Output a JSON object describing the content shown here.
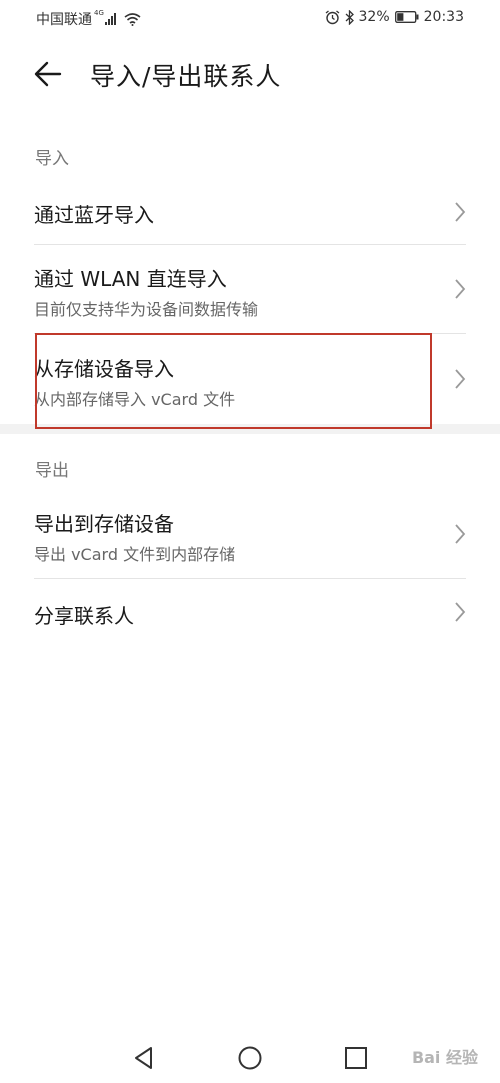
{
  "status_bar": {
    "carrier": "中国联通",
    "network": "4G",
    "battery": "32%",
    "time": "20:33"
  },
  "header": {
    "title": "导入/导出联系人",
    "back_icon": "arrow-left-icon"
  },
  "import_section": {
    "label": "导入",
    "items": [
      {
        "title": "通过蓝牙导入",
        "subtitle": ""
      },
      {
        "title": "通过 WLAN 直连导入",
        "subtitle": "目前仅支持华为设备间数据传输"
      },
      {
        "title": "从存储设备导入",
        "subtitle": "从内部存储导入 vCard 文件"
      }
    ]
  },
  "export_section": {
    "label": "导出",
    "items": [
      {
        "title": "导出到存储设备",
        "subtitle": "导出 vCard 文件到内部存储"
      },
      {
        "title": "分享联系人",
        "subtitle": ""
      }
    ]
  },
  "navbar": {
    "icons": [
      "back-triangle-icon",
      "home-circle-icon",
      "recents-square-icon"
    ]
  },
  "watermark": "Bai 经验",
  "colors": {
    "highlight": "#c0392b",
    "divider": "#e4e4e4",
    "section_label": "#777777"
  }
}
